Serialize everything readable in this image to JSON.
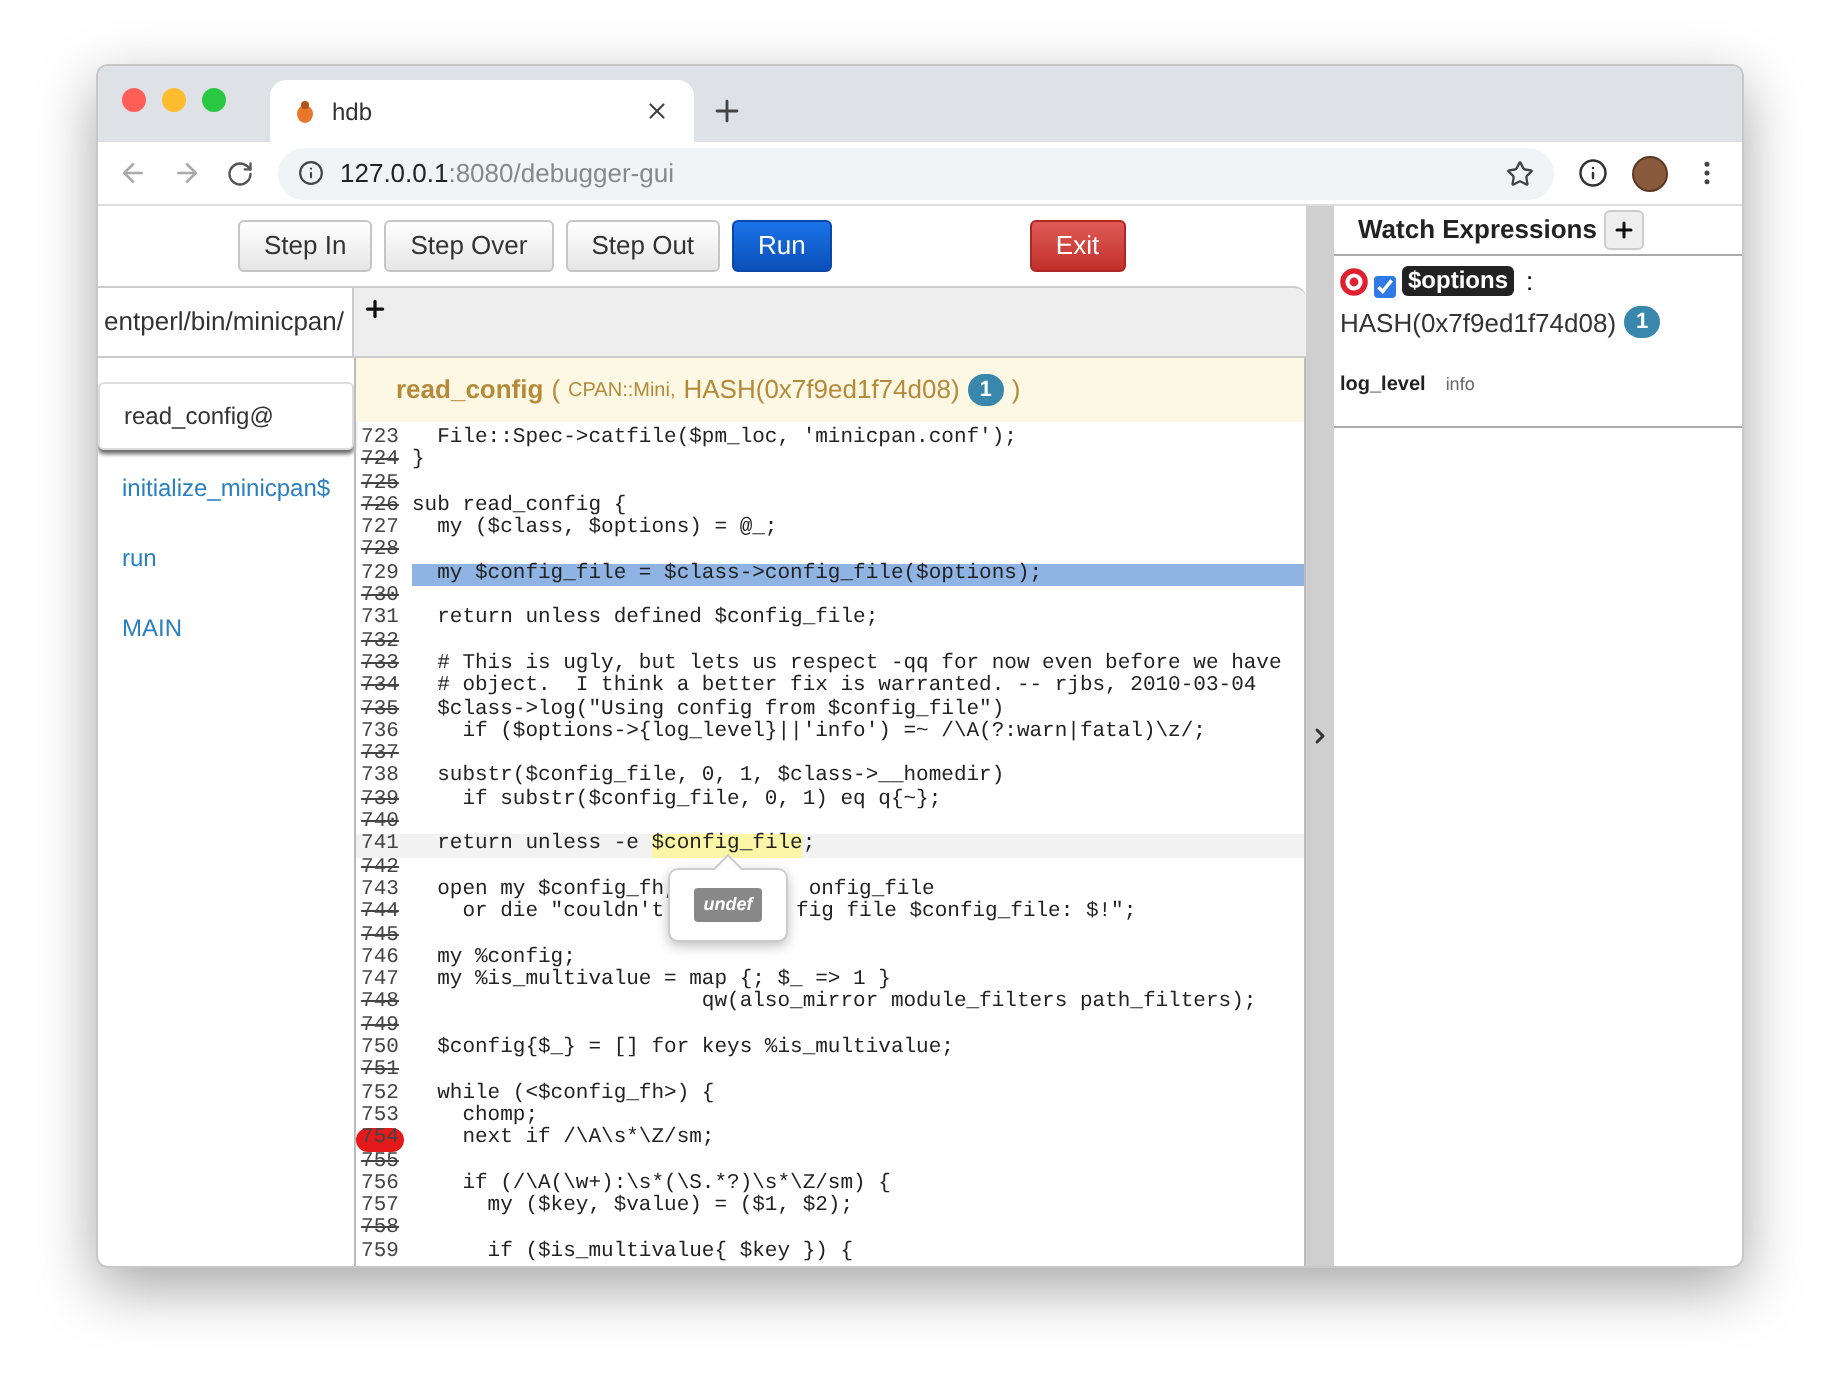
{
  "browser": {
    "tab_title": "hdb",
    "url_host": "127.0.0.1",
    "url_rest": ":8080/debugger-gui"
  },
  "toolbar": {
    "buttons": [
      {
        "label": "Step In",
        "kind": "default"
      },
      {
        "label": "Step Over",
        "kind": "default"
      },
      {
        "label": "Step Out",
        "kind": "default"
      },
      {
        "label": "Run",
        "kind": "primary"
      },
      {
        "label": "Exit",
        "kind": "danger"
      }
    ]
  },
  "file_tabs": [
    {
      "label": "entperl/bin/minicpan/",
      "selected": true
    }
  ],
  "stack_frames": [
    {
      "label": "read_config@",
      "selected": true
    },
    {
      "label": "initialize_minicpan$",
      "selected": false
    },
    {
      "label": "run",
      "selected": false
    },
    {
      "label": "MAIN",
      "selected": false
    }
  ],
  "frame_header": {
    "sub": "read_config",
    "open_paren": "(",
    "package": "CPAN::Mini,",
    "value": "HASH(0x7f9ed1f74d08)",
    "count": "1",
    "close_paren": ")"
  },
  "code_lines": [
    {
      "n": "723",
      "breakable": true,
      "current": false,
      "breakpoint": false,
      "hovered": false,
      "text": "  File::Spec->catfile($pm_loc, 'minicpan.conf');"
    },
    {
      "n": "724",
      "breakable": false,
      "current": false,
      "breakpoint": false,
      "hovered": false,
      "text": "}"
    },
    {
      "n": "725",
      "breakable": false,
      "current": false,
      "breakpoint": false,
      "hovered": false
    },
    {
      "n": "726",
      "breakable": false,
      "current": false,
      "breakpoint": false,
      "hovered": false,
      "text": "sub read_config {"
    },
    {
      "n": "727",
      "breakable": true,
      "current": false,
      "breakpoint": false,
      "hovered": false,
      "text": "  my ($class, $options) = @_;"
    },
    {
      "n": "728",
      "breakable": false,
      "current": false,
      "breakpoint": false,
      "hovered": false
    },
    {
      "n": "729",
      "breakable": true,
      "current": true,
      "breakpoint": false,
      "hovered": false,
      "text": "  my $config_file = $class->config_file($options);"
    },
    {
      "n": "730",
      "breakable": false,
      "current": false,
      "breakpoint": false,
      "hovered": false
    },
    {
      "n": "731",
      "breakable": true,
      "current": false,
      "breakpoint": false,
      "hovered": false,
      "text": "  return unless defined $config_file;"
    },
    {
      "n": "732",
      "breakable": false,
      "current": false,
      "breakpoint": false,
      "hovered": false
    },
    {
      "n": "733",
      "breakable": false,
      "current": false,
      "breakpoint": false,
      "hovered": false,
      "text": "  # This is ugly, but lets us respect -qq for now even before we have"
    },
    {
      "n": "734",
      "breakable": false,
      "current": false,
      "breakpoint": false,
      "hovered": false,
      "text": "  # object.  I think a better fix is warranted. -- rjbs, 2010-03-04"
    },
    {
      "n": "735",
      "breakable": false,
      "current": false,
      "breakpoint": false,
      "hovered": false,
      "text": "  $class->log(\"Using config from $config_file\")"
    },
    {
      "n": "736",
      "breakable": true,
      "current": false,
      "breakpoint": false,
      "hovered": false,
      "text": "    if ($options->{log_level}||'info') =~ /\\A(?:warn|fatal)\\z/;"
    },
    {
      "n": "737",
      "breakable": false,
      "current": false,
      "breakpoint": false,
      "hovered": false
    },
    {
      "n": "738",
      "breakable": true,
      "current": false,
      "breakpoint": false,
      "hovered": false,
      "text": "  substr($config_file, 0, 1, $class->__homedir)"
    },
    {
      "n": "739",
      "breakable": false,
      "current": false,
      "breakpoint": false,
      "hovered": false,
      "text": "    if substr($config_file, 0, 1) eq q{~};"
    },
    {
      "n": "740",
      "breakable": false,
      "current": false,
      "breakpoint": false,
      "hovered": false
    },
    {
      "n": "741",
      "breakable": true,
      "current": false,
      "breakpoint": false,
      "hovered": true,
      "parts": [
        {
          "kind": "text",
          "text": "  return unless -e ",
          "highlighted": false
        },
        {
          "kind": "text",
          "text": "$config_file",
          "highlighted": true
        },
        {
          "kind": "text",
          "text": ";",
          "highlighted": false
        }
      ]
    },
    {
      "n": "742",
      "breakable": false,
      "current": false,
      "breakpoint": false,
      "hovered": false
    },
    {
      "n": "743",
      "breakable": true,
      "current": false,
      "breakpoint": false,
      "hovered": false,
      "parts": [
        {
          "kind": "text",
          "text": "  open my $config_fh,",
          "highlighted": false
        },
        {
          "kind": "covered"
        },
        {
          "kind": "text",
          "text": "onfig_file",
          "highlighted": false
        }
      ]
    },
    {
      "n": "744",
      "breakable": false,
      "current": false,
      "breakpoint": false,
      "hovered": false,
      "parts": [
        {
          "kind": "text",
          "text": "    or die \"couldn't",
          "highlighted": false
        },
        {
          "kind": "covered"
        },
        {
          "kind": "text",
          "text": "fig file $config_file: $!\";",
          "highlighted": false
        }
      ]
    },
    {
      "n": "745",
      "breakable": false,
      "current": false,
      "breakpoint": false,
      "hovered": false
    },
    {
      "n": "746",
      "breakable": true,
      "current": false,
      "breakpoint": false,
      "hovered": false,
      "text": "  my %config;"
    },
    {
      "n": "747",
      "breakable": true,
      "current": false,
      "breakpoint": false,
      "hovered": false,
      "text": "  my %is_multivalue = map {; $_ => 1 }"
    },
    {
      "n": "748",
      "breakable": false,
      "current": false,
      "breakpoint": false,
      "hovered": false,
      "text": "                       qw(also_mirror module_filters path_filters);"
    },
    {
      "n": "749",
      "breakable": false,
      "current": false,
      "breakpoint": false,
      "hovered": false
    },
    {
      "n": "750",
      "breakable": true,
      "current": false,
      "breakpoint": false,
      "hovered": false,
      "text": "  $config{$_} = [] for keys %is_multivalue;"
    },
    {
      "n": "751",
      "breakable": false,
      "current": false,
      "breakpoint": false,
      "hovered": false
    },
    {
      "n": "752",
      "breakable": true,
      "current": false,
      "breakpoint": false,
      "hovered": false,
      "text": "  while (<$config_fh>) {"
    },
    {
      "n": "753",
      "breakable": true,
      "current": false,
      "breakpoint": false,
      "hovered": false,
      "text": "    chomp;"
    },
    {
      "n": "754",
      "breakable": true,
      "current": false,
      "breakpoint": true,
      "hovered": false,
      "text": "    next if /\\A\\s*\\Z/sm;"
    },
    {
      "n": "755",
      "breakable": false,
      "current": false,
      "breakpoint": false,
      "hovered": false
    },
    {
      "n": "756",
      "breakable": true,
      "current": false,
      "breakpoint": false,
      "hovered": false,
      "text": "    if (/\\A(\\w+):\\s*(\\S.*?)\\s*\\Z/sm) {"
    },
    {
      "n": "757",
      "breakable": true,
      "current": false,
      "breakpoint": false,
      "hovered": false,
      "text": "      my ($key, $value) = ($1, $2);"
    },
    {
      "n": "758",
      "breakable": false,
      "current": false,
      "breakpoint": false,
      "hovered": false
    },
    {
      "n": "759",
      "breakable": true,
      "current": false,
      "breakpoint": false,
      "hovered": false,
      "text": "      if ($is_multivalue{ $key }) {"
    }
  ],
  "popover": {
    "value": "undef"
  },
  "watch": {
    "title": "Watch Expressions",
    "expressions": [
      {
        "name": "$options",
        "enabled": true,
        "separator": ":",
        "value": "HASH(0x7f9ed1f74d08)",
        "count": "1",
        "fields": [
          {
            "key": "log_level",
            "value": "info"
          }
        ]
      }
    ]
  }
}
